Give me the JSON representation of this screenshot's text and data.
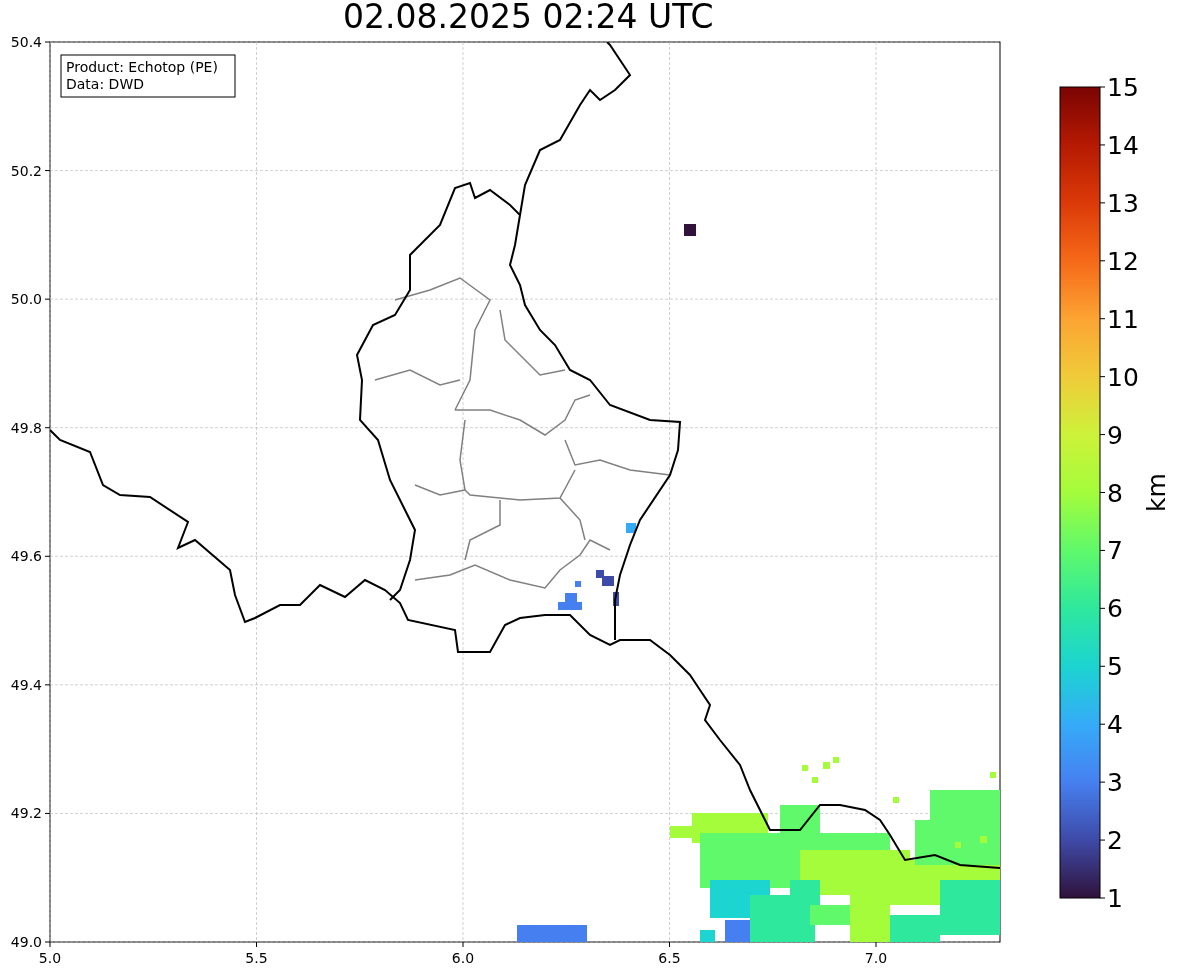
{
  "title": "02.08.2025 02:24 UTC",
  "info_box": [
    "Product: Echotop (PE)",
    "Data: DWD"
  ],
  "x_axis": {
    "ticks": [
      "5.0",
      "5.5",
      "6.0",
      "6.5",
      "7.0"
    ]
  },
  "y_axis": {
    "ticks": [
      "50.4",
      "50.2",
      "50.0",
      "49.8",
      "49.6",
      "49.4",
      "49.2",
      "49.0"
    ]
  },
  "colorbar": {
    "label": "km",
    "ticks": [
      "15",
      "14",
      "13",
      "12",
      "11",
      "10",
      "9",
      "8",
      "7",
      "6",
      "5",
      "4",
      "3",
      "2",
      "1"
    ]
  }
}
